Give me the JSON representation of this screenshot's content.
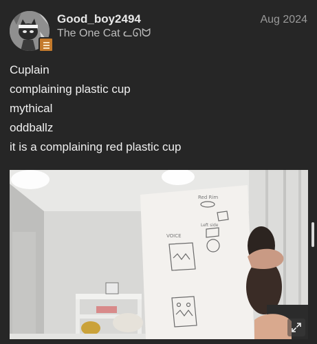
{
  "post": {
    "username": "Good_boy2494",
    "user_title": "The One Cat ᓚᘏᗢ",
    "date": "Aug 2024",
    "lines": [
      "Cuplain",
      "complaining plastic cup",
      "mythical",
      "oddballz",
      "it is a complaining red plastic cup"
    ]
  },
  "photo": {
    "drawing_labels": [
      "Red Rim",
      "VOICE",
      "Left side"
    ]
  },
  "icons": {
    "avatar": "cat-avatar-icon",
    "badge": "flair-badge-icon",
    "expand": "expand-icon"
  },
  "colors": {
    "background": "#262626",
    "badge": "#c47a2c"
  }
}
